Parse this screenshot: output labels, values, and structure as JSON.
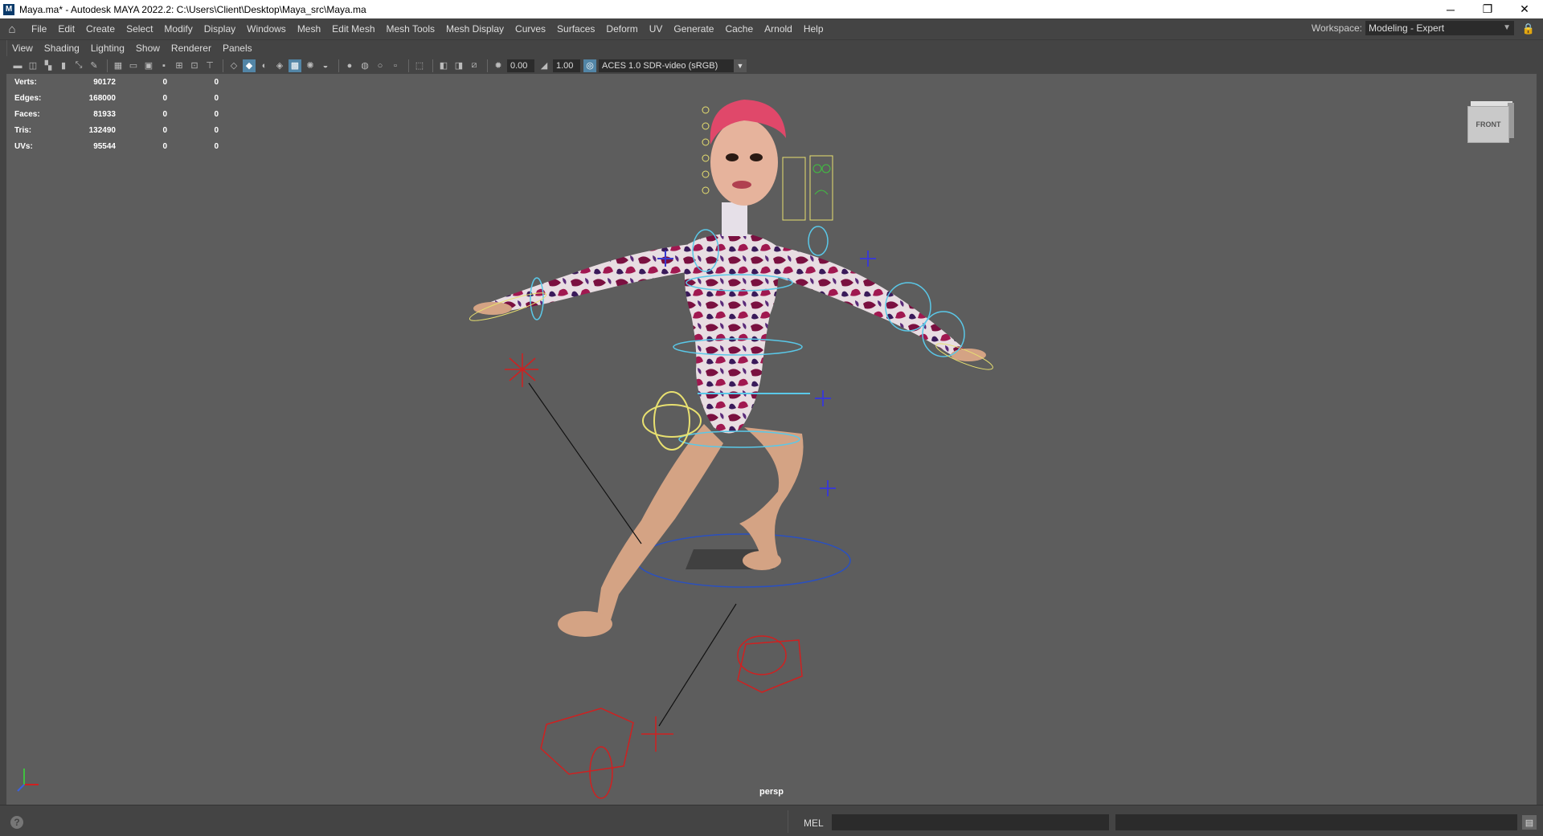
{
  "window": {
    "title": "Maya.ma* - Autodesk MAYA 2022.2: C:\\Users\\Client\\Desktop\\Maya_src\\Maya.ma",
    "app_icon": "M",
    "minimize": "─",
    "restore": "❐",
    "close": "✕"
  },
  "menubar": {
    "items": [
      "File",
      "Edit",
      "Create",
      "Select",
      "Modify",
      "Display",
      "Windows",
      "Mesh",
      "Edit Mesh",
      "Mesh Tools",
      "Mesh Display",
      "Curves",
      "Surfaces",
      "Deform",
      "UV",
      "Generate",
      "Cache",
      "Arnold",
      "Help"
    ],
    "workspace_label": "Workspace:",
    "workspace_value": "Modeling - Expert"
  },
  "panel_menu": {
    "items": [
      "View",
      "Shading",
      "Lighting",
      "Show",
      "Renderer",
      "Panels"
    ]
  },
  "toolbar": {
    "exposure": "0.00",
    "gamma": "1.00",
    "color_space": "ACES 1.0 SDR-video (sRGB)"
  },
  "hud": {
    "rows": [
      {
        "label": "Verts:",
        "a": "90172",
        "b": "0",
        "c": "0"
      },
      {
        "label": "Edges:",
        "a": "168000",
        "b": "0",
        "c": "0"
      },
      {
        "label": "Faces:",
        "a": "81933",
        "b": "0",
        "c": "0"
      },
      {
        "label": "Tris:",
        "a": "132490",
        "b": "0",
        "c": "0"
      },
      {
        "label": "UVs:",
        "a": "95544",
        "b": "0",
        "c": "0"
      }
    ]
  },
  "viewcube": {
    "face": "FRONT"
  },
  "camera_label": "persp",
  "statusbar": {
    "mel_label": "MEL",
    "help": "?"
  },
  "colors": {
    "viewport_bg": "#5d5d5d",
    "ui_bg": "#444444",
    "accent": "#5285a6",
    "rig_red": "#d02020",
    "rig_cyan": "#5ac8e8",
    "rig_yellow": "#e8e070",
    "rig_blue": "#3a3ad0"
  }
}
